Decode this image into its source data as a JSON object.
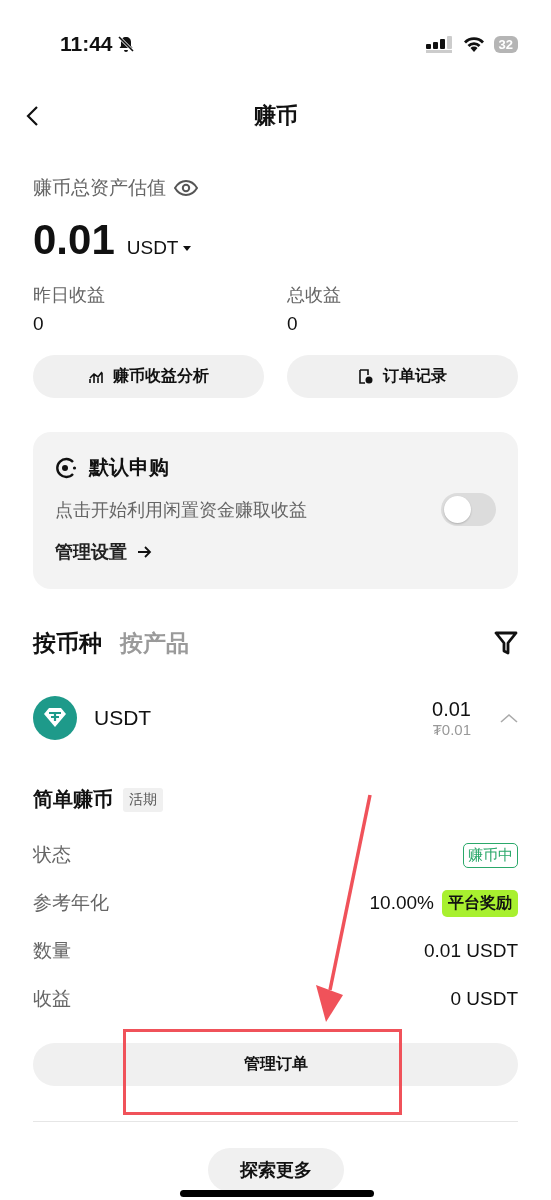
{
  "status_bar": {
    "time": "11:44",
    "battery": "32"
  },
  "nav": {
    "title": "赚币"
  },
  "summary": {
    "label": "赚币总资产估值",
    "value": "0.01",
    "currency": "USDT",
    "stats": [
      {
        "label": "昨日收益",
        "value": "0"
      },
      {
        "label": "总收益",
        "value": "0"
      }
    ],
    "actions": [
      {
        "label": "赚币收益分析",
        "kind": "chart"
      },
      {
        "label": "订单记录",
        "kind": "record"
      }
    ]
  },
  "auto_subscribe": {
    "title": "默认申购",
    "description": "点击开始利用闲置资金赚取收益",
    "on": false,
    "link": "管理设置"
  },
  "tabs": [
    {
      "label": "按币种",
      "selected": true
    },
    {
      "label": "按产品",
      "selected": false
    }
  ],
  "asset": {
    "coin": "USDT",
    "amount": "0.01",
    "value": "₮0.01",
    "expanded": true
  },
  "product": {
    "title": "简单赚币",
    "tag": "活期",
    "rows": [
      {
        "label": "状态",
        "value": "赚币中",
        "kind": "status"
      },
      {
        "label": "参考年化",
        "value": "10.00%",
        "badge": "平台奖励",
        "kind": "rate"
      },
      {
        "label": "数量",
        "value": "0.01 USDT",
        "kind": "plain"
      },
      {
        "label": "收益",
        "value": "0 USDT",
        "kind": "plain"
      }
    ]
  },
  "manage_button": "管理订单",
  "explore_button": "探索更多"
}
